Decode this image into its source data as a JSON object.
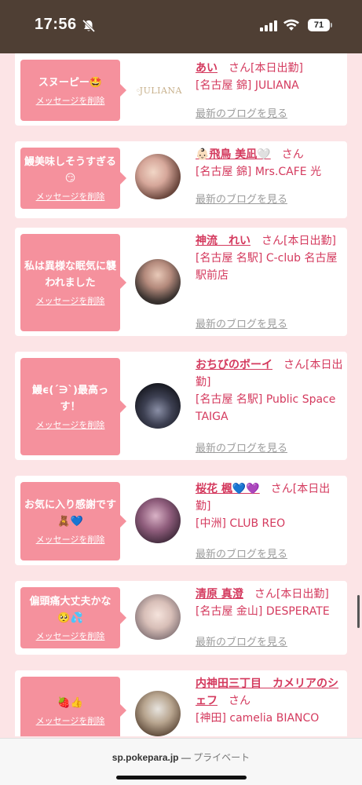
{
  "status": {
    "time": "17:56",
    "battery": "71"
  },
  "messages": [
    {
      "message": "スヌーピー🤩",
      "delete_label": "メッセージを削除",
      "logo_text": "JULIANA",
      "name": "あい",
      "suffix": "さん[本日出勤]",
      "shop": "[名古屋 錦] JULIANA",
      "blog_label": "最新のブログを見る"
    },
    {
      "message": "鰻美味しそうすぎる😏",
      "delete_label": "メッセージを削除",
      "name": "👶🏻飛鳥 美凪🤍",
      "suffix": "さん",
      "shop": "[名古屋 錦] Mrs.CAFE 光",
      "blog_label": "最新のブログを見る"
    },
    {
      "message": "私は異様な眠気に襲われました",
      "delete_label": "メッセージを削除",
      "name": "神流　れい",
      "suffix": "さん[本日出勤]",
      "shop": "[名古屋 名駅] C-club 名古屋駅前店",
      "blog_label": "最新のブログを見る"
    },
    {
      "message": "鰻ϵ(´∋`)最高っす！",
      "delete_label": "メッセージを削除",
      "name": "おちびのボーイ",
      "suffix": "さん[本日出勤]",
      "shop": "[名古屋 名駅] Public Space TAIGA",
      "blog_label": "最新のブログを見る"
    },
    {
      "message": "お気に入り感謝です🧸💙",
      "delete_label": "メッセージを削除",
      "name": "桜花 楓💙💜",
      "suffix": "さん[本日出勤]",
      "shop": "[中洲] CLUB REO",
      "blog_label": "最新のブログを見る"
    },
    {
      "message": "偏頭痛大丈夫かな🥺💦",
      "delete_label": "メッセージを削除",
      "name": "清原 真澄",
      "suffix": "さん[本日出勤]",
      "shop": "[名古屋 金山] DESPERATE",
      "blog_label": "最新のブログを見る"
    },
    {
      "message": "🍓👍",
      "delete_label": "メッセージを削除",
      "name": "内神田三丁目　カメリアのシェフ",
      "suffix": "さん",
      "shop": "[神田] camelia BIANCO",
      "blog_label": ""
    }
  ],
  "browser": {
    "domain": "sp.pokepara.jp",
    "separator": " — ",
    "mode": "プライベート"
  }
}
